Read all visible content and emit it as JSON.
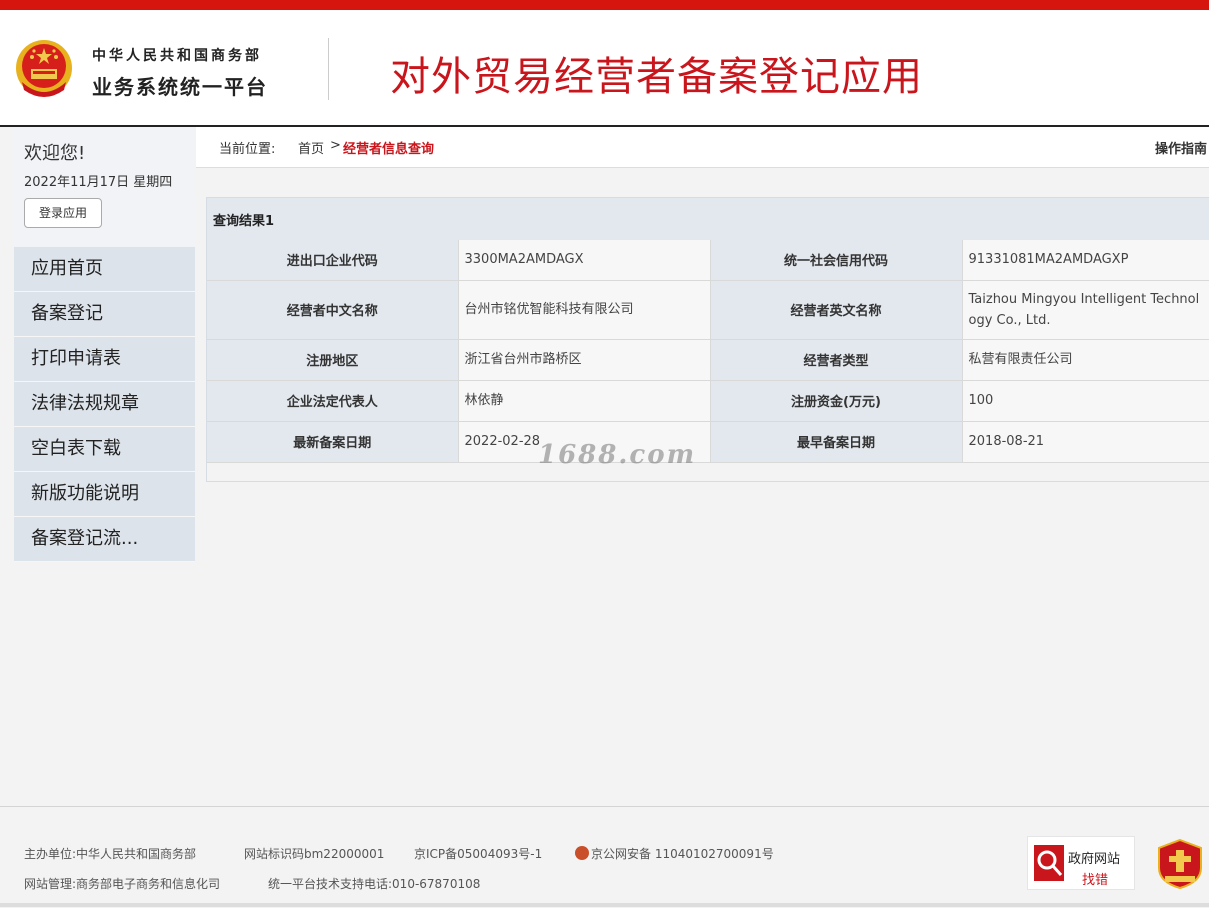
{
  "header": {
    "org_line1": "中华人民共和国商务部",
    "org_line2": "业务系统统一平台",
    "app_title": "对外贸易经营者备案登记应用",
    "accent_color": "#d7150f"
  },
  "sidebar": {
    "welcome": "欢迎您!",
    "date": "2022年11月17日 星期四",
    "login_button": "登录应用",
    "items": [
      {
        "label": "应用首页"
      },
      {
        "label": "备案登记"
      },
      {
        "label": "打印申请表"
      },
      {
        "label": "法律法规规章"
      },
      {
        "label": "空白表下载"
      },
      {
        "label": "新版功能说明"
      },
      {
        "label": "备案登记流..."
      }
    ]
  },
  "breadcrumb": {
    "label": "当前位置:",
    "home": "首页",
    "separator": ">",
    "current": "经营者信息查询",
    "guide": "操作指南"
  },
  "result": {
    "title": "查询结果1",
    "rows": [
      {
        "l1": "进出口企业代码",
        "v1": "3300MA2AMDAGX",
        "l2": "统一社会信用代码",
        "v2": "91331081MA2AMDAGXP"
      },
      {
        "l1": "经营者中文名称",
        "v1": "台州市铭优智能科技有限公司",
        "l2": "经营者英文名称",
        "v2": "Taizhou Mingyou Intelligent Technology Co., Ltd."
      },
      {
        "l1": "注册地区",
        "v1": "浙江省台州市路桥区",
        "l2": "经营者类型",
        "v2": "私营有限责任公司"
      },
      {
        "l1": "企业法定代表人",
        "v1": "林依静",
        "l2": "注册资金(万元)",
        "v2": "100"
      },
      {
        "l1": "最新备案日期",
        "v1": "2022-02-28",
        "l2": "最早备案日期",
        "v2": "2018-08-21"
      }
    ]
  },
  "watermark": "1688.com",
  "footer": {
    "sponsor": "主办单位:中华人民共和国商务部",
    "site_id": "网站标识码bm22000001",
    "icp": "京ICP备05004093号-1",
    "police": "京公网安备 11040102700091号",
    "manager": "网站管理:商务部电子商务和信息化司",
    "hotline": "统一平台技术支持电话:010-67870108",
    "gov_badge_top": "政府网站",
    "gov_badge_bottom": "找错",
    "party_badge": "党政机关"
  }
}
